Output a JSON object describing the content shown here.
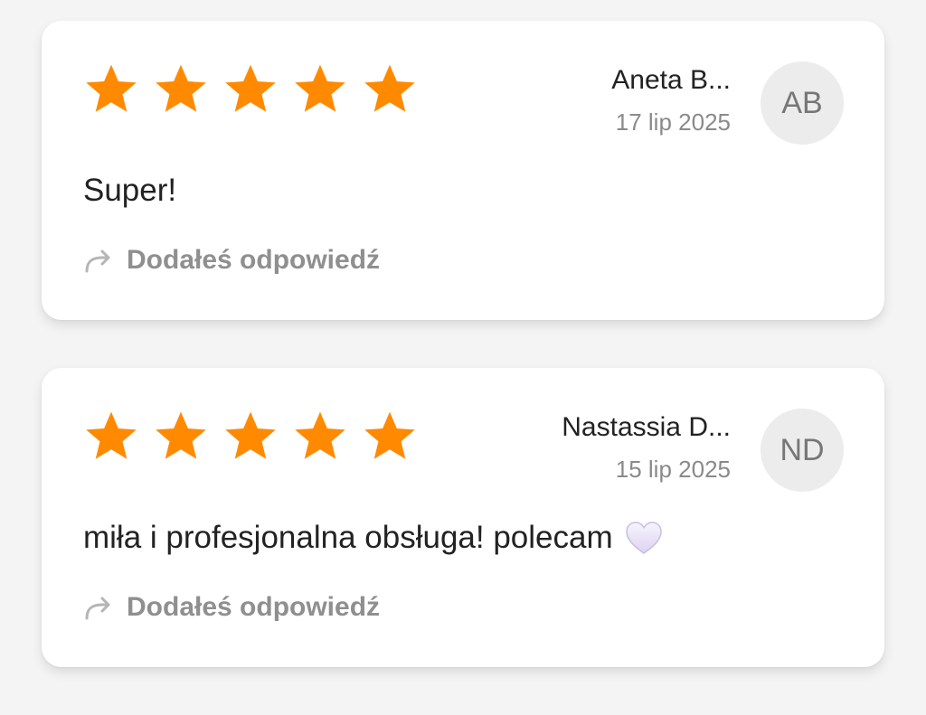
{
  "colors": {
    "background": "#f4f4f4",
    "card": "#ffffff",
    "star": "#ff8a00",
    "avatar_bg": "#ececec",
    "muted_text": "#8f8f8f",
    "heart": "#e9e2f7"
  },
  "reviews": [
    {
      "rating": 5,
      "author": "Aneta B...",
      "date": "17 lip 2025",
      "initials": "AB",
      "text": "Super!",
      "emoji_icon": null,
      "reply_label": "Dodałeś odpowiedź",
      "reply_icon": "reply-arrow-icon"
    },
    {
      "rating": 5,
      "author": "Nastassia D...",
      "date": "15 lip 2025",
      "initials": "ND",
      "text": "miła i profesjonalna obsługa! polecam",
      "emoji_icon": "white-heart-icon",
      "reply_label": "Dodałeś odpowiedź",
      "reply_icon": "reply-arrow-icon"
    }
  ],
  "icons": {
    "star": "star-icon",
    "reply": "reply-arrow-icon",
    "heart": "white-heart-icon"
  }
}
